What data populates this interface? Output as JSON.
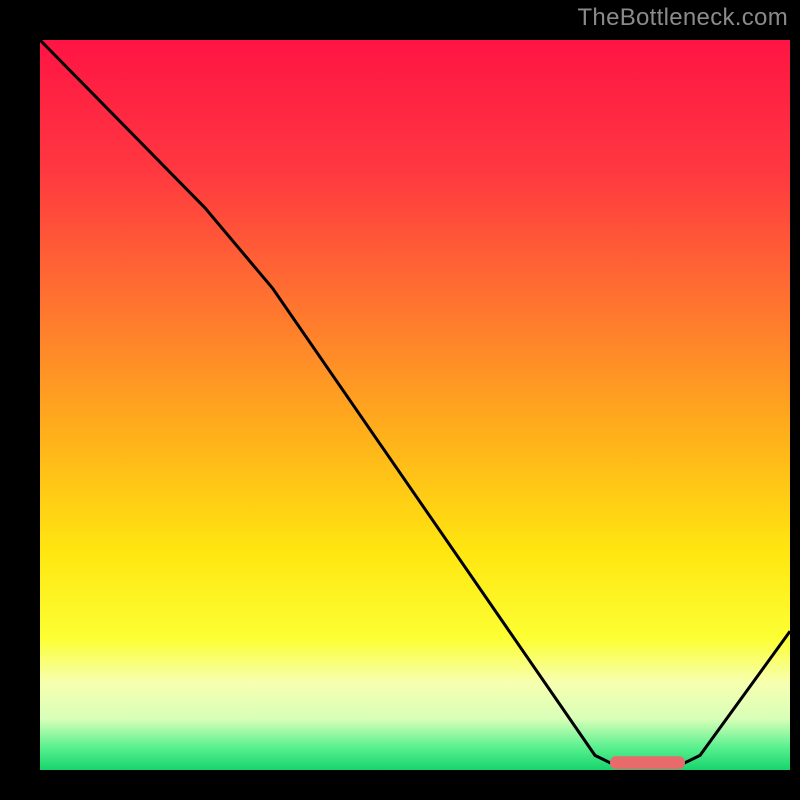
{
  "attribution": "TheBottleneck.com",
  "chart_data": {
    "type": "line",
    "title": "",
    "xlabel": "",
    "ylabel": "",
    "xlim": [
      0,
      100
    ],
    "ylim": [
      0,
      100
    ],
    "background_gradient_stops": [
      {
        "offset": 0,
        "color": "#ff1444"
      },
      {
        "offset": 18,
        "color": "#ff3840"
      },
      {
        "offset": 38,
        "color": "#ff7a2e"
      },
      {
        "offset": 55,
        "color": "#ffb31a"
      },
      {
        "offset": 70,
        "color": "#ffe610"
      },
      {
        "offset": 82,
        "color": "#fcff34"
      },
      {
        "offset": 88,
        "color": "#f7ffb0"
      },
      {
        "offset": 93,
        "color": "#d8ffb8"
      },
      {
        "offset": 97,
        "color": "#56f08e"
      },
      {
        "offset": 100,
        "color": "#17d46c"
      }
    ],
    "series": [
      {
        "name": "curve",
        "color": "#000000",
        "points": [
          {
            "x": 0,
            "y": 100
          },
          {
            "x": 22,
            "y": 77
          },
          {
            "x": 31,
            "y": 66
          },
          {
            "x": 74,
            "y": 2
          },
          {
            "x": 77,
            "y": 0.5
          },
          {
            "x": 85,
            "y": 0.5
          },
          {
            "x": 88,
            "y": 2
          },
          {
            "x": 100,
            "y": 19
          }
        ]
      }
    ],
    "optimal_marker": {
      "x_start": 76,
      "x_end": 86,
      "y": 1,
      "color": "#e86a6a"
    }
  }
}
